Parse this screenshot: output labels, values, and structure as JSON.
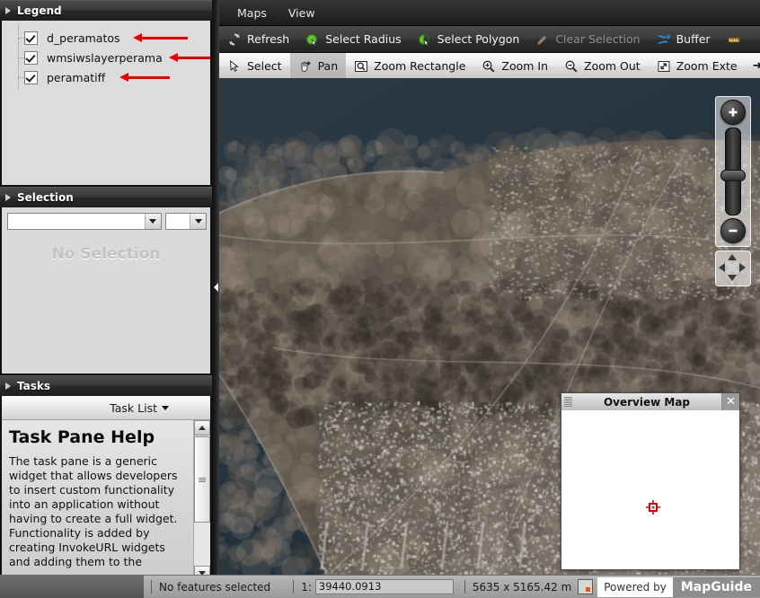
{
  "legend": {
    "title": "Legend",
    "items": [
      {
        "label": "d_peramatos",
        "checked": true
      },
      {
        "label": "wmsiwslayerperama",
        "checked": true
      },
      {
        "label": "peramatiff",
        "checked": true
      }
    ]
  },
  "selection": {
    "title": "Selection",
    "dropdown_primary_value": "",
    "dropdown_secondary_value": "",
    "empty_message": "No Selection"
  },
  "tasks": {
    "title": "Tasks",
    "task_list_label": "Task List",
    "help_heading": "Task Pane Help",
    "help_body": "The task pane is a generic widget that allows developers to insert custom functionality into an application without having to create a full widget. Functionality is added by creating InvokeURL widgets and adding them to the"
  },
  "menubar": {
    "items": [
      {
        "label": "Maps"
      },
      {
        "label": "View"
      }
    ]
  },
  "toolbar_primary": {
    "buttons": [
      {
        "label": "Refresh",
        "icon": "refresh-icon",
        "state": "enabled"
      },
      {
        "label": "Select Radius",
        "icon": "select-radius-icon",
        "state": "enabled"
      },
      {
        "label": "Select Polygon",
        "icon": "select-polygon-icon",
        "state": "enabled"
      },
      {
        "label": "Clear Selection",
        "icon": "clear-selection-icon",
        "state": "disabled"
      },
      {
        "label": "Buffer",
        "icon": "buffer-icon",
        "state": "enabled"
      },
      {
        "label": "",
        "icon": "measure-icon",
        "state": "enabled"
      }
    ],
    "overflow_label": "➜"
  },
  "toolbar_secondary": {
    "buttons": [
      {
        "label": "Select",
        "icon": "cursor-arrow-icon",
        "state": "enabled"
      },
      {
        "label": "Pan",
        "icon": "pan-hand-icon",
        "state": "active"
      },
      {
        "label": "Zoom Rectangle",
        "icon": "zoom-rectangle-icon",
        "state": "enabled"
      },
      {
        "label": "Zoom In",
        "icon": "zoom-in-icon",
        "state": "enabled"
      },
      {
        "label": "Zoom Out",
        "icon": "zoom-out-icon",
        "state": "enabled"
      },
      {
        "label": "Zoom Exte",
        "icon": "zoom-extents-icon",
        "state": "enabled"
      }
    ],
    "overflow_label": "➜"
  },
  "overview_map": {
    "title": "Overview Map",
    "close_label": "✕"
  },
  "status": {
    "selection_text": "No features selected",
    "scale_label": "1:",
    "scale_value": "39440.0913",
    "extent_text": "5635 x 5165.42 m",
    "powered_by": "Powered by",
    "product": "MapGuide"
  },
  "colors": {
    "annotation": "#ee0000",
    "accent_green": "#63c02e",
    "accent_blue": "#2b8ede"
  }
}
